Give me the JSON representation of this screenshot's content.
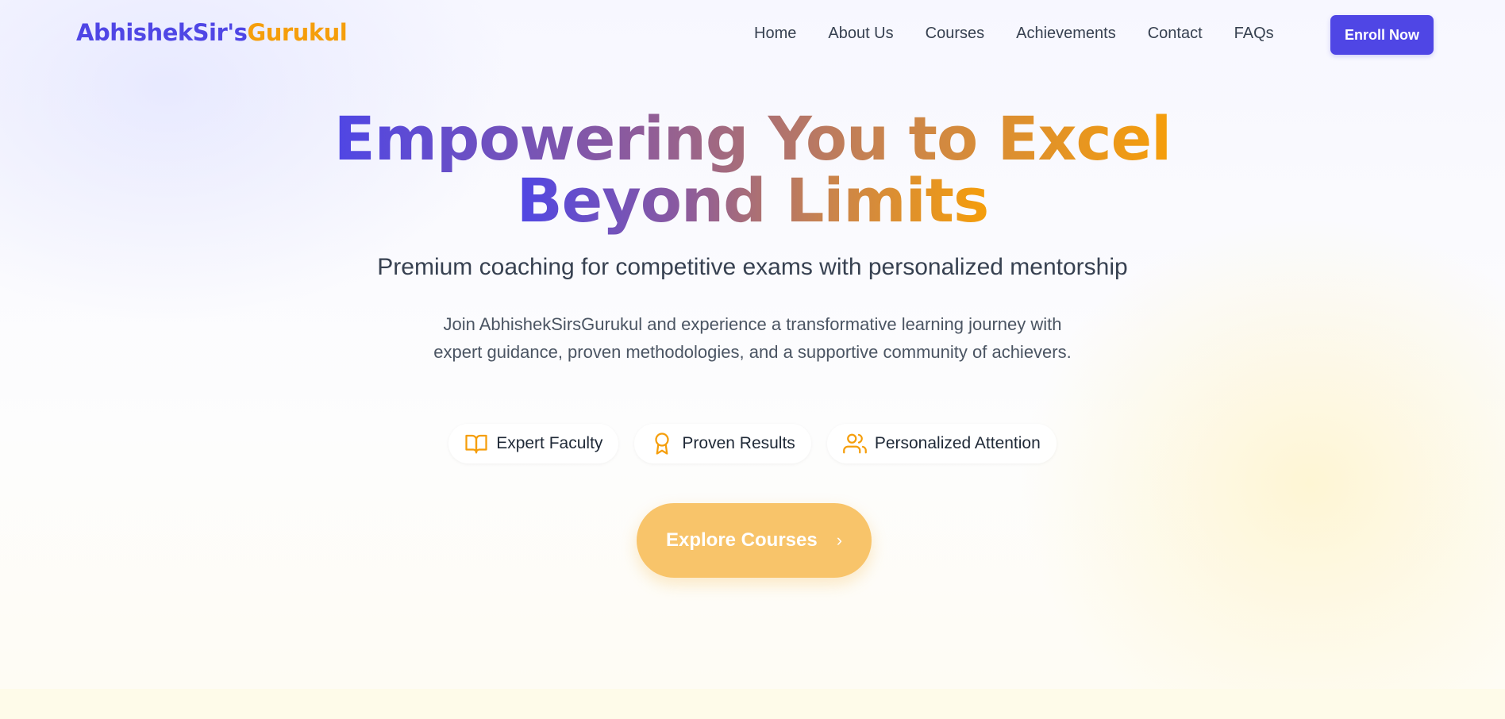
{
  "brand": {
    "part1": "AbhishekSir's",
    "part2": "Gurukul"
  },
  "nav": {
    "links": [
      "Home",
      "About Us",
      "Courses",
      "Achievements",
      "Contact",
      "FAQs"
    ],
    "cta": "Enroll Now"
  },
  "hero": {
    "title_line1": "Empowering You to Excel",
    "title_line2": "Beyond Limits",
    "subtitle": "Premium coaching for competitive exams with personalized mentorship",
    "description": "Join AbhishekSirsGurukul and experience a transformative learning journey with expert guidance, proven methodologies, and a supportive community of achievers.",
    "features": [
      {
        "icon": "book-open-icon",
        "label": "Expert Faculty"
      },
      {
        "icon": "award-icon",
        "label": "Proven Results"
      },
      {
        "icon": "users-icon",
        "label": "Personalized Attention"
      }
    ],
    "cta": "Explore Courses",
    "cta_icon": "chevron-right-icon"
  },
  "colors": {
    "primary": "#4f46e5",
    "accent": "#f59e0b",
    "cta_bg": "#f8c46a"
  }
}
